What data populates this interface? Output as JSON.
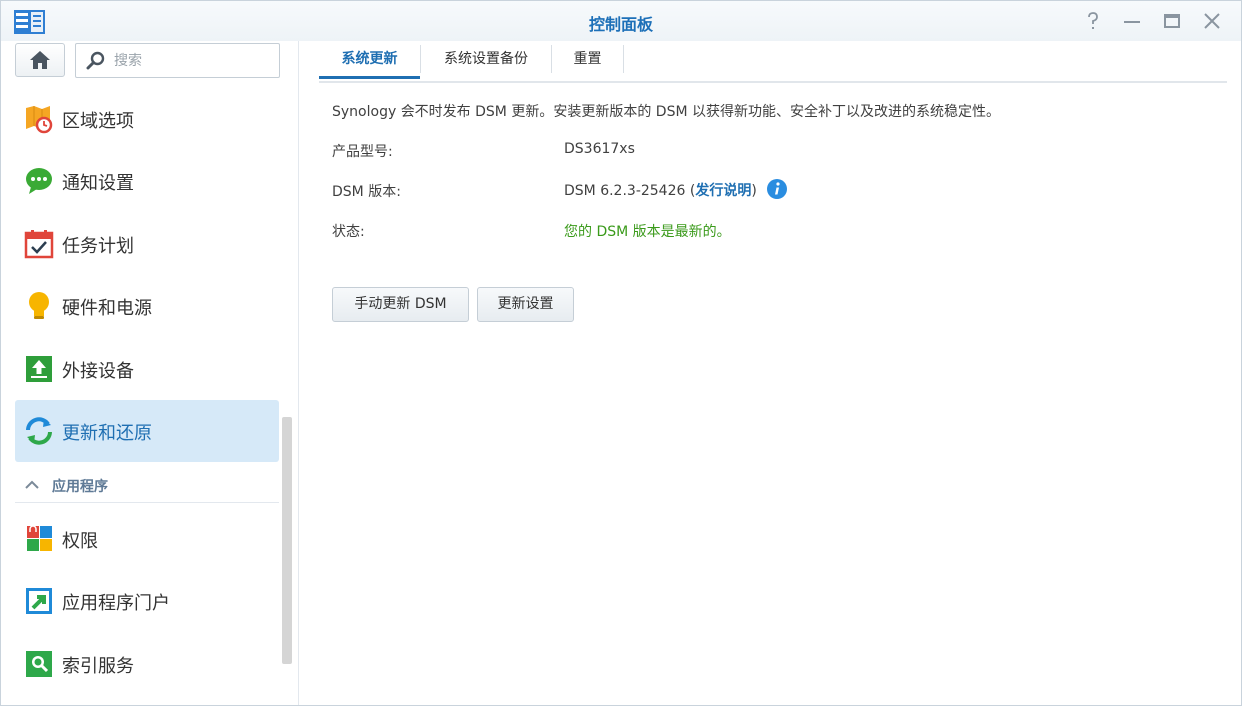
{
  "window": {
    "title": "控制面板",
    "controls": [
      "help-icon",
      "minimize-icon",
      "maximize-icon",
      "close-icon"
    ]
  },
  "sidebar": {
    "search_placeholder": "搜索",
    "items": [
      {
        "label": "区域选项",
        "icon": "regional-options-icon"
      },
      {
        "label": "通知设置",
        "icon": "notification-icon"
      },
      {
        "label": "任务计划",
        "icon": "task-scheduler-icon"
      },
      {
        "label": "硬件和电源",
        "icon": "hardware-power-icon"
      },
      {
        "label": "外接设备",
        "icon": "external-devices-icon"
      },
      {
        "label": "更新和还原",
        "icon": "update-restore-icon",
        "active": true
      }
    ],
    "section": {
      "label": "应用程序"
    },
    "app_items": [
      {
        "label": "权限",
        "icon": "privileges-icon"
      },
      {
        "label": "应用程序门户",
        "icon": "application-portal-icon"
      },
      {
        "label": "索引服务",
        "icon": "indexing-service-icon"
      }
    ]
  },
  "main": {
    "tabs": [
      {
        "label": "系统更新",
        "active": true
      },
      {
        "label": "系统设置备份"
      },
      {
        "label": "重置"
      }
    ],
    "description": "Synology 会不时发布 DSM 更新。安装更新版本的 DSM 以获得新功能、安全补丁以及改进的系统稳定性。",
    "product_label": "产品型号:",
    "product_value": "DS3617xs",
    "version_label": "DSM 版本:",
    "version_value": "DSM 6.2.3-25426",
    "version_paren_open": " (",
    "release_notes": "发行说明",
    "version_paren_close": ")",
    "status_label": "状态:",
    "status_value": "您的 DSM 版本是最新的。",
    "buttons": {
      "manual_update": "手动更新 DSM",
      "update_settings": "更新设置"
    }
  },
  "colors": {
    "accent": "#1f6fb2",
    "status_ok": "#3a9a1a",
    "active_bg": "#d6e9f8"
  }
}
